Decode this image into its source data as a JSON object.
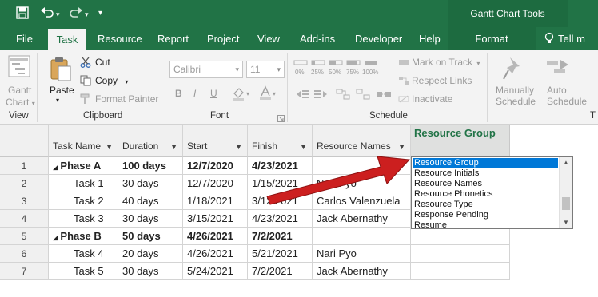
{
  "titlebar": {
    "context_tab_title": "Gantt Chart Tools",
    "qat_icons": [
      "save-icon",
      "undo-icon",
      "redo-icon",
      "customize-qat-icon"
    ]
  },
  "ribbon_tabs": [
    "File",
    "Task",
    "Resource",
    "Report",
    "Project",
    "View",
    "Add-ins",
    "Developer",
    "Help",
    "Format",
    "Tell m"
  ],
  "active_tab": "Task",
  "ribbon": {
    "view_group": {
      "button": [
        "Gantt",
        "Chart"
      ],
      "label": "View"
    },
    "clipboard": {
      "paste": "Paste",
      "cut": "Cut",
      "copy": "Copy",
      "format_painter": "Format Painter",
      "label": "Clipboard"
    },
    "font": {
      "font_name": "Calibri",
      "font_size": "11",
      "bold": "B",
      "italic": "I",
      "underline": "U",
      "label": "Font"
    },
    "schedule": {
      "percent_buttons": [
        "0%",
        "25%",
        "50%",
        "75%",
        "100%"
      ],
      "mark_on_track": "Mark on Track",
      "respect_links": "Respect Links",
      "inactivate": "Inactivate",
      "label": "Schedule"
    },
    "tasks": {
      "manually": [
        "Manually",
        "Schedule"
      ],
      "auto": [
        "Auto",
        "Schedule"
      ],
      "label": "T"
    }
  },
  "grid": {
    "columns": [
      "Task Name",
      "Duration",
      "Start",
      "Finish",
      "Resource Names"
    ],
    "new_column_header": "Resource Group",
    "rows": [
      {
        "num": "1",
        "name": "Phase A",
        "duration": "100 days",
        "start": "12/7/2020",
        "finish": "4/23/2021",
        "resource": "",
        "summary": true
      },
      {
        "num": "2",
        "name": "Task 1",
        "duration": "30 days",
        "start": "12/7/2020",
        "finish": "1/15/2021",
        "resource": "Nari Pyo",
        "summary": false
      },
      {
        "num": "3",
        "name": "Task 2",
        "duration": "40 days",
        "start": "1/18/2021",
        "finish": "3/12/2021",
        "resource": "Carlos Valenzuela",
        "summary": false
      },
      {
        "num": "4",
        "name": "Task 3",
        "duration": "30 days",
        "start": "3/15/2021",
        "finish": "4/23/2021",
        "resource": "Jack Abernathy",
        "summary": false
      },
      {
        "num": "5",
        "name": "Phase B",
        "duration": "50 days",
        "start": "4/26/2021",
        "finish": "7/2/2021",
        "resource": "",
        "summary": true
      },
      {
        "num": "6",
        "name": "Task 4",
        "duration": "20 days",
        "start": "4/26/2021",
        "finish": "5/21/2021",
        "resource": "Nari Pyo",
        "summary": false
      },
      {
        "num": "7",
        "name": "Task 5",
        "duration": "30 days",
        "start": "5/24/2021",
        "finish": "7/2/2021",
        "resource": "Jack Abernathy",
        "summary": false
      }
    ]
  },
  "field_list": {
    "options": [
      "Resource Group",
      "Resource Initials",
      "Resource Names",
      "Resource Phonetics",
      "Resource Type",
      "Response Pending",
      "Resume"
    ],
    "selected": "Resource Group"
  },
  "colors": {
    "brand_green": "#217346",
    "selection_blue": "#0078d7",
    "callout_arrow": "#cc1f1f"
  }
}
